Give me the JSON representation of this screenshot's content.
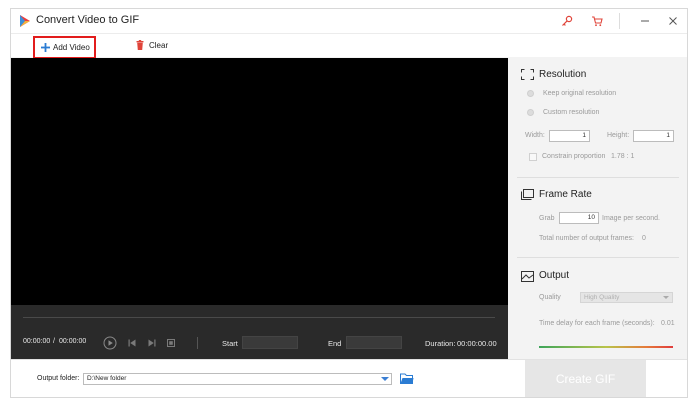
{
  "window": {
    "title": "Convert Video to GIF"
  },
  "toolbar": {
    "add_video_label": "Add Video",
    "clear_label": "Clear"
  },
  "player": {
    "current_time": "00:00:00",
    "separator": "/",
    "total_time": "00:00:00",
    "start_label": "Start",
    "end_label": "End",
    "duration_label": "Duration:",
    "duration_value": "00:00:00.00"
  },
  "resolution": {
    "title": "Resolution",
    "keep_original": "Keep original resolution",
    "custom": "Custom resolution",
    "width_label": "Width:",
    "width_value": "1",
    "height_label": "Height:",
    "height_value": "1",
    "constrain_label": "Constrain proportion",
    "constrain_ratio": "1.78 : 1"
  },
  "frame_rate": {
    "title": "Frame Rate",
    "grab_label": "Grab",
    "grab_value": "10",
    "per_second_label": "Image per second.",
    "total_frames_label": "Total number of output frames:",
    "total_frames_value": "0"
  },
  "output": {
    "title": "Output",
    "quality_label": "Quality",
    "quality_value": "High Quality",
    "delay_label": "Time delay for each frame (seconds):",
    "delay_value": "0.01"
  },
  "bottom": {
    "output_folder_label": "Output folder:",
    "output_folder_value": "D:\\New folder",
    "create_gif_label": "Create GIF"
  },
  "icons": {
    "logo": "app-logo-icon",
    "key": "key-icon",
    "cart": "cart-icon",
    "minimize": "minimize-icon",
    "close": "close-icon",
    "add": "plus-icon",
    "clear": "trash-icon",
    "play": "play-icon",
    "prev": "previous-icon",
    "next": "next-icon",
    "snapshot": "snapshot-icon",
    "folder": "folder-icon"
  },
  "colors": {
    "accent": "#e21c1c",
    "add_icon": "#2b7cd3",
    "player_bg": "#000000",
    "controls_bg": "#2a2a2a"
  }
}
